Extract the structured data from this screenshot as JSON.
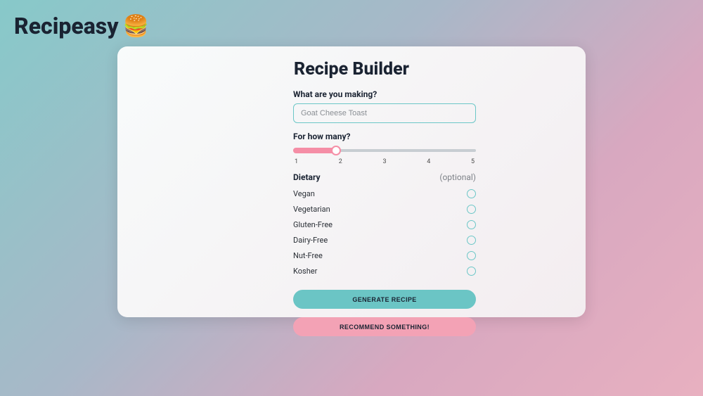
{
  "brand": {
    "name": "Recipeasy",
    "emoji": "🍔"
  },
  "card": {
    "title": "Recipe Builder"
  },
  "form": {
    "making_label": "What are you making?",
    "making_placeholder": "Goat Cheese Toast",
    "making_value": "",
    "how_many_label": "For how many?",
    "slider": {
      "min": 1,
      "max": 5,
      "value": 2,
      "ticks": [
        "1",
        "2",
        "3",
        "4",
        "5"
      ]
    },
    "dietary_title": "Dietary",
    "dietary_optional": "(optional)",
    "dietary_options": [
      {
        "label": "Vegan",
        "checked": false
      },
      {
        "label": "Vegetarian",
        "checked": false
      },
      {
        "label": "Gluten-Free",
        "checked": false
      },
      {
        "label": "Dairy-Free",
        "checked": false
      },
      {
        "label": "Nut-Free",
        "checked": false
      },
      {
        "label": "Kosher",
        "checked": false
      }
    ]
  },
  "buttons": {
    "generate": "Generate Recipe",
    "recommend": "Recommend something!"
  },
  "colors": {
    "accent_teal": "#6bc5c5",
    "accent_pink": "#f3a2b5",
    "slider_pink": "#f58ea6"
  }
}
